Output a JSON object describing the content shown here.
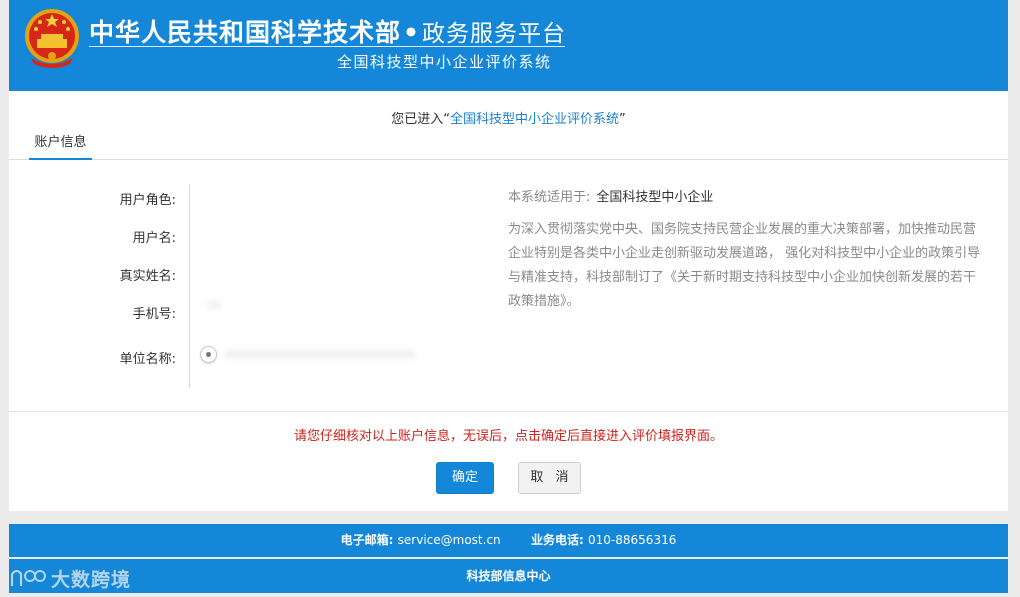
{
  "header": {
    "title": "中华人民共和国科学技术部",
    "title_dot": "•",
    "title_suffix": "政务服务平台",
    "subtitle": "全国科技型中小企业评价系统"
  },
  "welcome": {
    "prefix": "您已进入",
    "open_quote": "“",
    "system_name": "全国科技型中小企业评价系统",
    "close_quote": "”"
  },
  "tabs": [
    {
      "label": "账户信息",
      "active": true
    }
  ],
  "account_fields": [
    {
      "label": "用户角色:"
    },
    {
      "label": "用户名:"
    },
    {
      "label": "真实姓名:"
    },
    {
      "label": "手机号:"
    },
    {
      "label": "单位名称:"
    }
  ],
  "applies": {
    "label": "本系统适用于:",
    "value": "全国科技型中小企业"
  },
  "description": "为深入贯彻落实党中央、国务院支持民营企业发展的重大决策部署，加快推动民营企业特别是各类中小企业走创新驱动发展道路， 强化对科技型中小企业的政策引导与精准支持，科技部制订了《关于新时期支持科技型中小企业加快创新发展的若干政策措施》。",
  "notice": "请您仔细核对以上账户信息，无误后，点击确定后直接进入评价填报界面。",
  "buttons": {
    "ok": "确定",
    "cancel": "取 消"
  },
  "footer": {
    "email_label": "电子邮箱:",
    "email": "service@most.cn",
    "phone_label": "业务电话:",
    "phone": "010-88656316",
    "org": "科技部信息中心"
  },
  "watermark": {
    "text": "大数跨境"
  },
  "colors": {
    "brand_blue": "#1487d8",
    "link_blue": "#1b7fd1",
    "notice_red": "#d0221c",
    "page_bg": "#ececec"
  }
}
